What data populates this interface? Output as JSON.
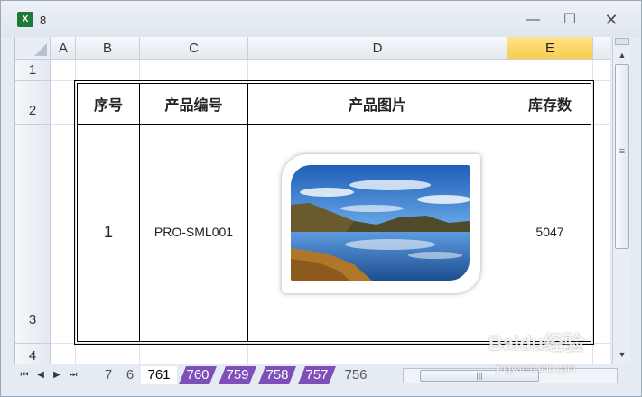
{
  "window": {
    "title": "8",
    "controls": {
      "minimize": "—",
      "maximize": "☐",
      "close": "✕"
    }
  },
  "sheet": {
    "columns": [
      "A",
      "B",
      "C",
      "D",
      "E"
    ],
    "active_column": "E",
    "rows": [
      "1",
      "2",
      "3",
      "4"
    ],
    "table": {
      "headers": [
        "序号",
        "产品编号",
        "产品图片",
        "库存数"
      ],
      "row": {
        "index": "1",
        "product_code": "PRO-SML001",
        "stock": "5047"
      }
    }
  },
  "tabs": {
    "items": [
      {
        "label": "7",
        "style": "plain"
      },
      {
        "label": "6",
        "style": "plain"
      },
      {
        "label": "761",
        "style": "active"
      },
      {
        "label": "760",
        "style": "purple"
      },
      {
        "label": "759",
        "style": "purple"
      },
      {
        "label": "758",
        "style": "purple"
      },
      {
        "label": "757",
        "style": "purple"
      },
      {
        "label": "756",
        "style": "plain"
      }
    ]
  },
  "watermark": {
    "text": "Baidu经验",
    "sub": "jingyan.baidu.com"
  },
  "colors": {
    "active_column_header": "#f7cc4f",
    "tab_purple": "#7e4fb8",
    "excel_green": "#1f7a3a"
  }
}
